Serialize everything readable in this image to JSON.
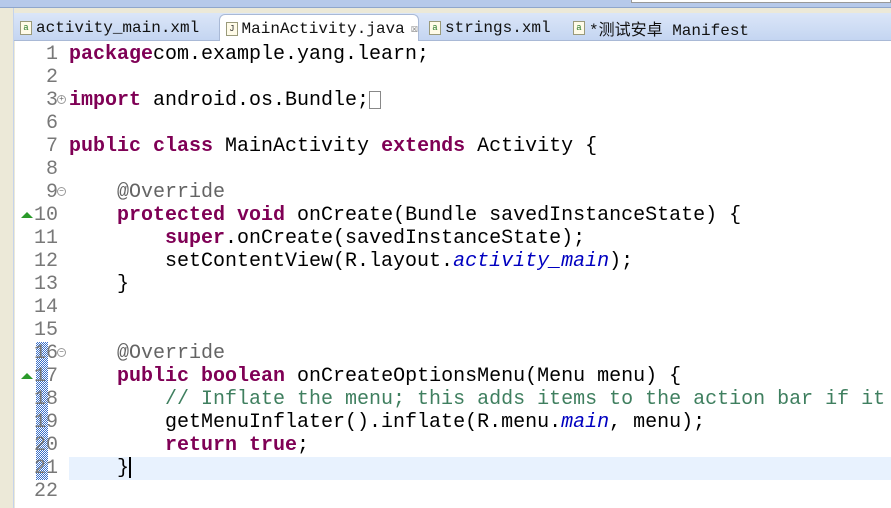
{
  "tabs": [
    {
      "label": "activity_main.xml",
      "icon": "xml-file-icon",
      "active": false
    },
    {
      "label": "MainActivity.java",
      "icon": "java-file-icon",
      "active": true
    },
    {
      "label": "strings.xml",
      "icon": "xml-file-icon",
      "active": false
    },
    {
      "label": "*测试安卓 Manifest",
      "icon": "manifest-file-icon",
      "active": false
    }
  ],
  "colors": {
    "keyword": "#7f0055",
    "comment": "#3f7f5f",
    "annotation": "#646464",
    "field": "#0000c0",
    "current_line": "#e8f2fe"
  },
  "lines": [
    {
      "n": "1",
      "t": [
        [
          "kw",
          "package"
        ],
        [
          "",
          "com.example.yang.learn;"
        ]
      ]
    },
    {
      "n": "2",
      "t": []
    },
    {
      "n": "3",
      "fold": "expand",
      "t": [
        [
          "kw",
          "import"
        ],
        [
          "",
          " android.os.Bundle;"
        ]
      ],
      "collapsed": true
    },
    {
      "n": "6",
      "t": []
    },
    {
      "n": "7",
      "t": [
        [
          "kw",
          "public class"
        ],
        [
          "",
          " MainActivity "
        ],
        [
          "kw",
          "extends"
        ],
        [
          "",
          " Activity {"
        ]
      ]
    },
    {
      "n": "8",
      "t": []
    },
    {
      "n": "9",
      "fold": "collapse",
      "t": [
        [
          "",
          "    "
        ],
        [
          "ann",
          "@Override"
        ]
      ]
    },
    {
      "n": "10",
      "override": true,
      "t": [
        [
          "",
          "    "
        ],
        [
          "kw",
          "protected void"
        ],
        [
          "",
          " onCreate(Bundle savedInstanceState) {"
        ]
      ]
    },
    {
      "n": "11",
      "t": [
        [
          "",
          "        "
        ],
        [
          "kw",
          "super"
        ],
        [
          "",
          ".onCreate(savedInstanceState);"
        ]
      ]
    },
    {
      "n": "12",
      "t": [
        [
          "",
          "        setContentView(R.layout."
        ],
        [
          "fi",
          "activity_main"
        ],
        [
          "",
          ");"
        ]
      ]
    },
    {
      "n": "13",
      "t": [
        [
          "",
          "    }"
        ]
      ]
    },
    {
      "n": "14",
      "t": []
    },
    {
      "n": "15",
      "t": []
    },
    {
      "n": "16",
      "fold": "collapse",
      "t": [
        [
          "",
          "    "
        ],
        [
          "ann",
          "@Override"
        ]
      ]
    },
    {
      "n": "17",
      "override": true,
      "t": [
        [
          "",
          "    "
        ],
        [
          "kw",
          "public boolean"
        ],
        [
          "",
          " onCreateOptionsMenu(Menu menu) {"
        ]
      ]
    },
    {
      "n": "18",
      "t": [
        [
          "",
          "        "
        ],
        [
          "cm",
          "// Inflate the menu; this adds items to the action bar if it"
        ]
      ]
    },
    {
      "n": "19",
      "t": [
        [
          "",
          "        getMenuInflater().inflate(R.menu."
        ],
        [
          "fi",
          "main"
        ],
        [
          "",
          ", menu);"
        ]
      ]
    },
    {
      "n": "20",
      "t": [
        [
          "",
          "        "
        ],
        [
          "kw",
          "return true"
        ],
        [
          "",
          ";"
        ]
      ]
    },
    {
      "n": "21",
      "current": true,
      "t": [
        [
          "",
          "    }"
        ]
      ]
    },
    {
      "n": "22",
      "t": []
    }
  ]
}
